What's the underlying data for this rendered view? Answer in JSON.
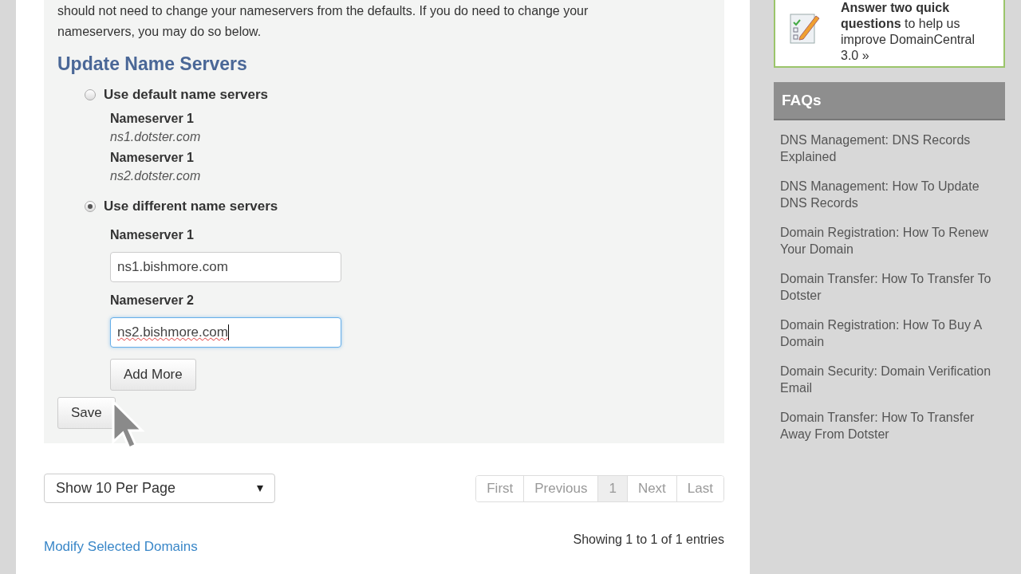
{
  "intro": "should not need to change your nameservers from the defaults. If you do need to change your nameservers, you may do so below.",
  "section_title": "Update Name Servers",
  "options": [
    {
      "label": "Use default name servers",
      "selected": false,
      "kind": "static",
      "servers": [
        {
          "label": "Nameserver 1",
          "value": "ns1.dotster.com"
        },
        {
          "label": "Nameserver 1",
          "value": "ns2.dotster.com"
        }
      ]
    },
    {
      "label": "Use different name servers",
      "selected": true,
      "kind": "fields",
      "servers": [
        {
          "label": "Nameserver 1",
          "value": "ns1.bishmore.com",
          "focused": false
        },
        {
          "label": "Nameserver 2",
          "value": "ns2.bishmore.com",
          "focused": true
        }
      ],
      "add_button": "Add More"
    }
  ],
  "save_button": "Save",
  "page_size": {
    "value": "Show 10 Per Page"
  },
  "pagination": [
    {
      "label": "First",
      "selected": false
    },
    {
      "label": "Previous",
      "selected": false
    },
    {
      "label": "1",
      "selected": true
    },
    {
      "label": "Next",
      "selected": false
    },
    {
      "label": "Last",
      "selected": false
    }
  ],
  "modify_link": "Modify Selected Domains",
  "entries_info": "Showing 1 to 1 of 1 entries",
  "survey": {
    "text": "**Answer two quick questions** to help us improve DomainCentral 3.0 »"
  },
  "faqs": {
    "title": "FAQs",
    "items": [
      "DNS Management: DNS Records Explained",
      "DNS Management: How To Update DNS Records",
      "Domain Registration: How To Renew Your Domain",
      "Domain Transfer: How To Transfer To Dotster",
      "Domain Registration: How To Buy A Domain",
      "Domain Security: Domain Verification Email",
      "Domain Transfer: How To Transfer Away From Dotster"
    ]
  }
}
